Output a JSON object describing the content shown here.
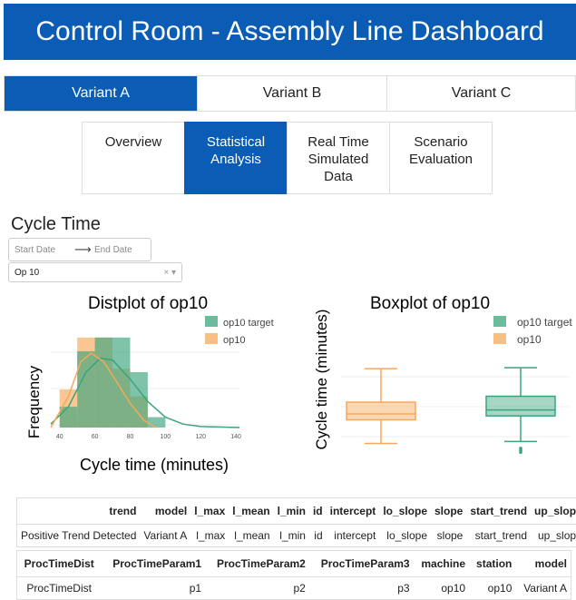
{
  "header": {
    "title": "Control Room - Assembly Line Dashboard"
  },
  "variant_tabs": [
    {
      "label": "Variant A",
      "active": true
    },
    {
      "label": "Variant B",
      "active": false
    },
    {
      "label": "Variant C",
      "active": false
    }
  ],
  "sub_tabs": [
    {
      "label": "Overview",
      "active": false
    },
    {
      "label": "Statistical\nAnalysis",
      "active": true
    },
    {
      "label": "Real Time\nSimulated\nData",
      "active": false
    },
    {
      "label": "Scenario\nEvaluation",
      "active": false
    }
  ],
  "section": {
    "title": "Cycle Time",
    "start_date_placeholder": "Start Date",
    "end_date_placeholder": "End Date",
    "operation_select": "Op 10"
  },
  "colors": {
    "brand": "#0b5cb5",
    "target": "#3aa57c",
    "actual": "#f5a95a"
  },
  "chart_data": [
    {
      "type": "histogram",
      "title": "Distplot of op10",
      "xlabel": "Cycle time (minutes)",
      "ylabel": "Frequency",
      "x_ticks": [
        "40",
        "60",
        "80",
        "100",
        "120",
        "140"
      ],
      "xlim": [
        35,
        142
      ],
      "legend": [
        "op10 target",
        "op10"
      ],
      "series": [
        {
          "name": "op10 target",
          "bins": [
            [
              40,
              50,
              0.6
            ],
            [
              50,
              60,
              2.2
            ],
            [
              60,
              70,
              2.6
            ],
            [
              70,
              80,
              2.6
            ],
            [
              80,
              90,
              1.6
            ],
            [
              90,
              100,
              0.3
            ]
          ],
          "curve": [
            [
              35,
              0.1
            ],
            [
              45,
              0.6
            ],
            [
              55,
              1.6
            ],
            [
              63,
              2.0
            ],
            [
              70,
              1.95
            ],
            [
              80,
              1.4
            ],
            [
              90,
              0.75
            ],
            [
              100,
              0.3
            ],
            [
              110,
              0.1
            ],
            [
              120,
              0.03
            ],
            [
              142,
              0.0
            ]
          ]
        },
        {
          "name": "op10",
          "bins": [
            [
              40,
              50,
              1.1
            ],
            [
              50,
              60,
              2.6
            ],
            [
              60,
              70,
              2.6
            ],
            [
              70,
              80,
              1.7
            ],
            [
              80,
              90,
              0.9
            ]
          ],
          "curve": [
            [
              35,
              0.0
            ],
            [
              45,
              0.9
            ],
            [
              52,
              1.9
            ],
            [
              58,
              2.15
            ],
            [
              65,
              1.9
            ],
            [
              72,
              1.35
            ],
            [
              80,
              0.7
            ],
            [
              88,
              0.2
            ],
            [
              95,
              0.0
            ]
          ]
        }
      ]
    },
    {
      "type": "box",
      "title": "Boxplot of op10",
      "ylabel": "Cycle time (minutes)",
      "legend": [
        "op10 target",
        "op10"
      ],
      "series": [
        {
          "name": "op10",
          "min": 38,
          "q1": 62,
          "median": 68,
          "q3": 80,
          "max": 114
        },
        {
          "name": "op10 target",
          "min": 40,
          "q1": 66,
          "median": 72,
          "q3": 86,
          "max": 115,
          "outliers": [
            33,
            31,
            29
          ]
        }
      ],
      "ylim": [
        20,
        140
      ]
    }
  ],
  "table1": {
    "headers": [
      "trend",
      "model",
      "l_max",
      "l_mean",
      "l_min",
      "id",
      "intercept",
      "lo_slope",
      "slope",
      "start_trend",
      "up_slope"
    ],
    "rows": [
      [
        "Positive Trend Detected",
        "Variant A",
        "l_max",
        "l_mean",
        "l_min",
        "id",
        "intercept",
        "lo_slope",
        "slope",
        "start_trend",
        "up_slope"
      ]
    ]
  },
  "table2": {
    "headers": [
      "ProcTimeDist",
      "ProcTimeParam1",
      "ProcTimeParam2",
      "ProcTimeParam3",
      "machine",
      "station",
      "model"
    ],
    "rows": [
      [
        "ProcTimeDist",
        "p1",
        "p2",
        "p3",
        "op10",
        "op10",
        "Variant A"
      ]
    ]
  }
}
